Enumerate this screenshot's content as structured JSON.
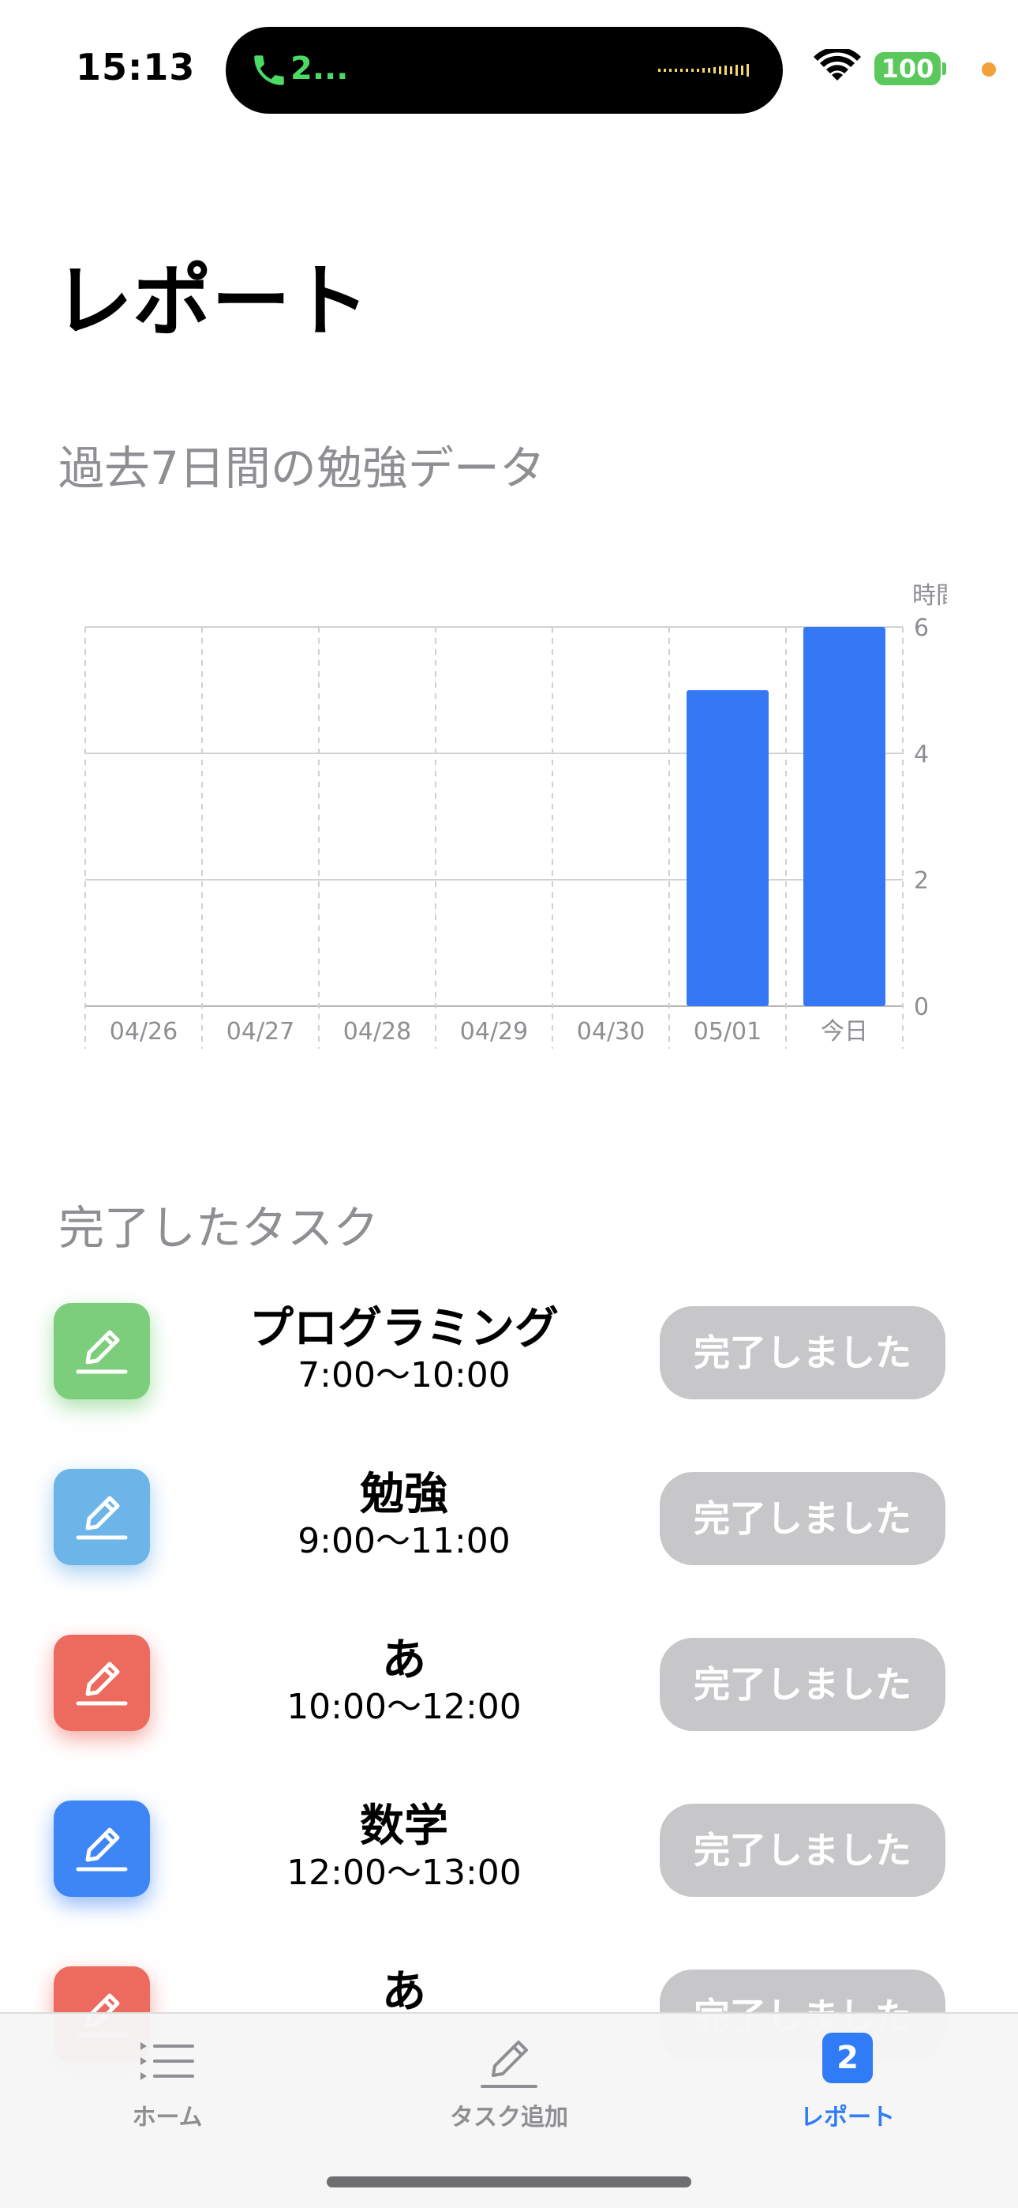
{
  "status": {
    "time": "15:13",
    "call": "2...",
    "battery": "100"
  },
  "page": {
    "title": "レポート"
  },
  "chart_section_title": "過去7日間の勉強データ",
  "chart_data": {
    "type": "bar",
    "ylabel": "時間",
    "categories": [
      "04/26",
      "04/27",
      "04/28",
      "04/29",
      "04/30",
      "05/01",
      "今日"
    ],
    "values": [
      0,
      0,
      0,
      0,
      0,
      5,
      6
    ],
    "ylim": [
      0,
      6
    ],
    "yticks": [
      "0",
      "2",
      "4",
      "6"
    ],
    "bar_color": "#3478f6",
    "grid": true
  },
  "tasks_section_title": "完了したタスク",
  "tasks": [
    {
      "name": "プログラミング",
      "time": "7:00〜10:00",
      "button": "完了しました",
      "color": "#7ccd7c",
      "shadow": "rgba(110,200,110,0.55)"
    },
    {
      "name": "勉強",
      "time": "9:00〜11:00",
      "button": "完了しました",
      "color": "#6db5e8",
      "shadow": "rgba(100,170,230,0.55)"
    },
    {
      "name": "あ",
      "time": "10:00〜12:00",
      "button": "完了しました",
      "color": "#ec6a5e",
      "shadow": "rgba(235,100,90,0.55)"
    },
    {
      "name": "数学",
      "time": "12:00〜13:00",
      "button": "完了しました",
      "color": "#3e86f5",
      "shadow": "rgba(60,130,245,0.55)"
    },
    {
      "name": "あ",
      "time": "",
      "button": "完了しました",
      "color": "#ec6a5e",
      "shadow": "rgba(235,100,90,0.55)"
    }
  ],
  "tabbar": {
    "home": "ホーム",
    "add_task": "タスク追加",
    "report": "レポート",
    "report_badge": "2"
  }
}
